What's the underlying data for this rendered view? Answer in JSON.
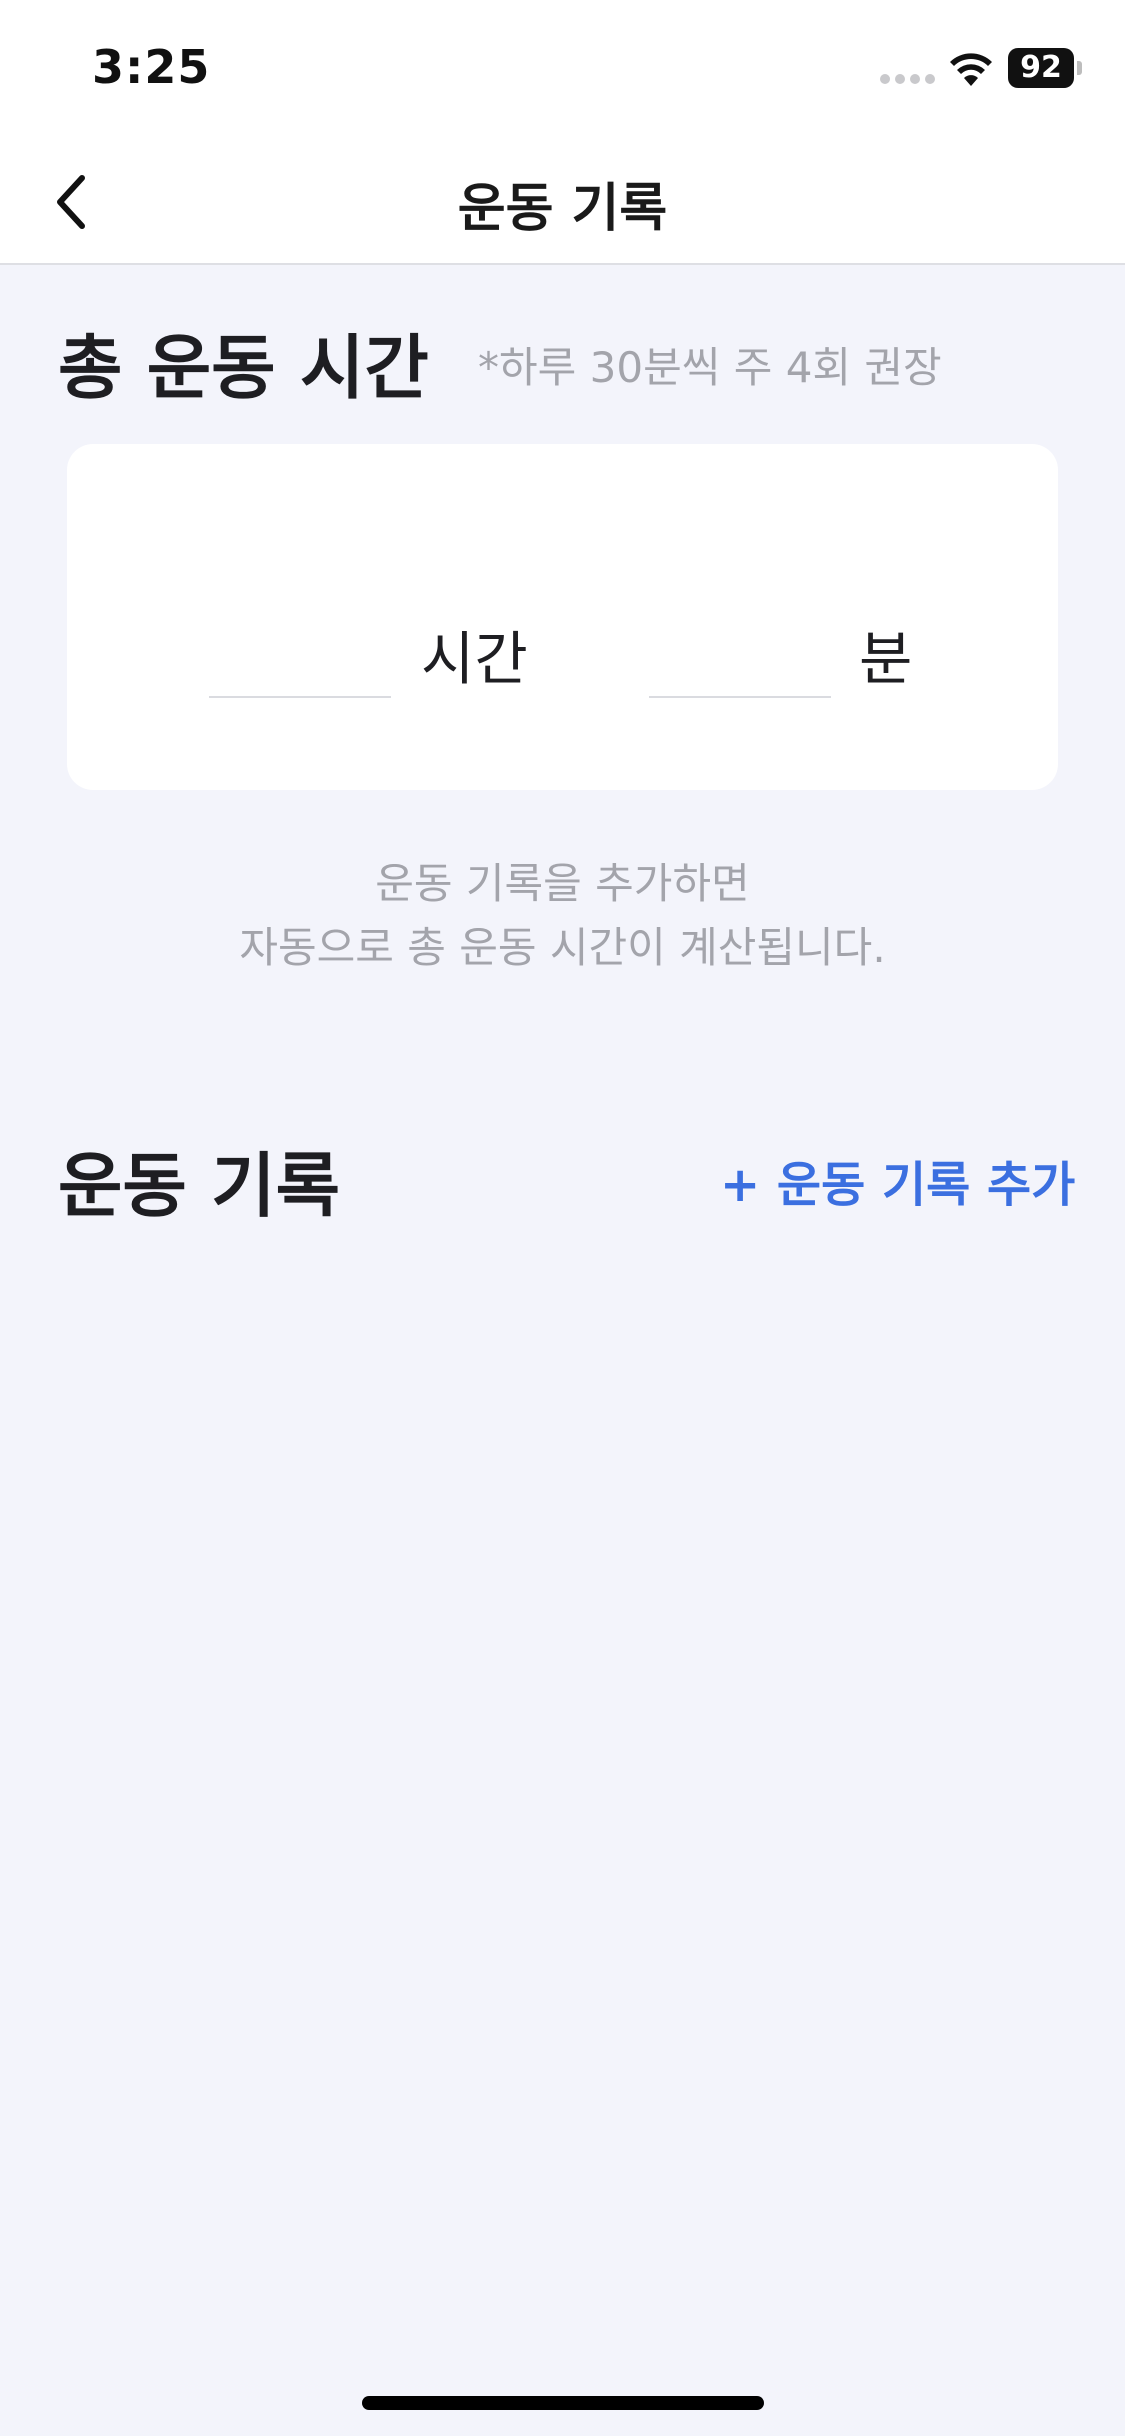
{
  "status_bar": {
    "time": "3:25",
    "battery": "92"
  },
  "nav": {
    "title": "운동 기록",
    "back_icon": "chevron-left-icon"
  },
  "total_time": {
    "title": "총 운동 시간",
    "hint": "*하루 30분씩 주 4회 권장",
    "hours_value": "",
    "hours_unit": "시간",
    "minutes_value": "",
    "minutes_unit": "분",
    "info_line1": "운동 기록을 추가하면",
    "info_line2": "자동으로 총 운동 시간이 계산됩니다."
  },
  "records": {
    "title": "운동 기록",
    "add_label": "+ 운동 기록 추가"
  },
  "colors": {
    "background": "#f3f4fb",
    "accent": "#3b6fe0",
    "muted_text": "#a3a4ab",
    "card": "#ffffff"
  }
}
